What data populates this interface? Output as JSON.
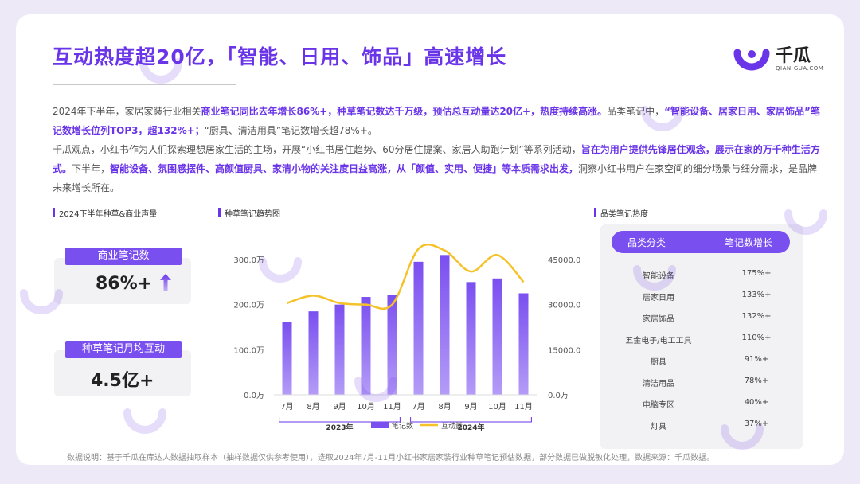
{
  "brand": {
    "name": "千瓜",
    "domain": "QIAN-GUA.COM",
    "accent": "#6a35e8",
    "bar_color": "#7a4ff0",
    "line_color": "#f5c22a"
  },
  "title": "互动热度超20亿，「智能、日用、饰品」高速增长",
  "paragraph": {
    "p1": [
      {
        "t": "2024年下半年，家居家装行业相关",
        "b": false
      },
      {
        "t": "商业笔记同比去年增长86%+，种草笔记数达千万级，预估总互动量达20亿+，热度持续高涨。",
        "b": true
      },
      {
        "t": "品类笔记中，",
        "b": false
      },
      {
        "t": "“智能设备、居家日用、家居饰品”笔记数增长位列TOP3，超132%+；",
        "b": true
      },
      {
        "t": "“厨具、清洁用具”笔记数增长超78%+。",
        "b": false
      }
    ],
    "p2": [
      {
        "t": "千瓜观点，小红书作为人们探索理想居家生活的主场，开展“小红书居住趋势、60分居住提案、家居人助跑计划”等系列活动，",
        "b": false
      },
      {
        "t": "旨在为用户提供先锋居住观念，展示在家的万千种生活方式。",
        "b": true
      },
      {
        "t": "下半年，",
        "b": false
      },
      {
        "t": "智能设备、氛围感摆件、高颜值厨具、家清小物的关注度日益高涨，从「颜值、实用、便捷」等本质需求出发，",
        "b": true
      },
      {
        "t": "洞察小红书用户在家空间的细分场景与细分需求，是品牌未来增长所在。",
        "b": false
      }
    ]
  },
  "left_panel": {
    "title": "2024下半年种草&商业声量",
    "stat1": {
      "label": "商业笔记数",
      "value": "86%+",
      "icon": "arrow-up-icon"
    },
    "stat2": {
      "label": "种草笔记月均互动",
      "value": "4.5亿+"
    }
  },
  "chart_title": "种草笔记趋势图",
  "chart_data": {
    "type": "bar",
    "categories": [
      "7月",
      "8月",
      "9月",
      "10月",
      "11月",
      "7月",
      "8月",
      "9月",
      "10月",
      "11月"
    ],
    "groups": [
      {
        "label": "2023年",
        "from": 0,
        "to": 4
      },
      {
        "label": "2024年",
        "from": 5,
        "to": 9
      }
    ],
    "series": [
      {
        "name": "笔记数",
        "type": "bar",
        "axis": "left",
        "values": [
          162,
          185,
          200,
          217,
          222,
          295,
          310,
          250,
          258,
          225
        ]
      },
      {
        "name": "互动量",
        "type": "line",
        "axis": "right",
        "values": [
          30500,
          33000,
          30500,
          30000,
          30000,
          48500,
          48000,
          41000,
          46500,
          37500
        ]
      }
    ],
    "y_left": {
      "ticks": [
        "0.0万",
        "100.0万",
        "200.0万",
        "300.0万"
      ],
      "range": [
        0,
        300
      ]
    },
    "y_right": {
      "ticks": [
        "0.0万",
        "15000.0万",
        "30000.0万",
        "45000.0万"
      ],
      "range": [
        0,
        45000
      ]
    },
    "legend": {
      "position": "bottom"
    },
    "grid": false
  },
  "table": {
    "title": "品类笔记热度",
    "headers": [
      "品类分类",
      "笔记数增长"
    ],
    "rows": [
      [
        "智能设备",
        "175%+"
      ],
      [
        "居家日用",
        "133%+"
      ],
      [
        "家居饰品",
        "132%+"
      ],
      [
        "五金电子/电工工具",
        "110%+"
      ],
      [
        "厨具",
        "91%+"
      ],
      [
        "清洁用品",
        "78%+"
      ],
      [
        "电脑专区",
        "40%+"
      ],
      [
        "灯具",
        "37%+"
      ]
    ]
  },
  "footnote": "数据说明：基于千瓜在库达人数据抽取样本（抽样数据仅供参考使用），选取2024年7月-11月小红书家居家装行业种草笔记预估数据，部分数据已做脱敏化处理，数据来源：千瓜数据。"
}
